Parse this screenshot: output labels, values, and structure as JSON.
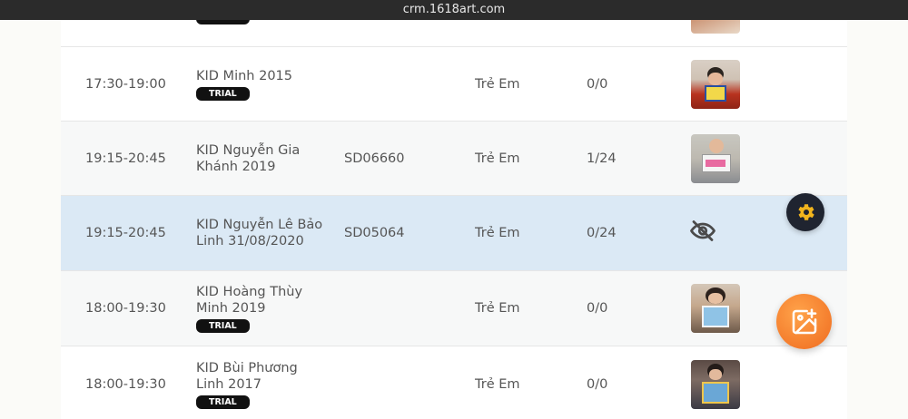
{
  "browser": {
    "url": "crm.1618art.com"
  },
  "rows": [
    {
      "time": "",
      "name": "",
      "badge": "TRIAL",
      "code": "",
      "type": "",
      "count": "",
      "thumb": "photo-thumbnail"
    },
    {
      "time": "17:30-19:00",
      "name": "KID Minh 2015",
      "badge": "TRIAL",
      "code": "",
      "type": "Trẻ Em",
      "count": "0/0",
      "thumb": "photo-thumbnail"
    },
    {
      "time": "19:15-20:45",
      "name": "KID Nguyễn Gia Khánh 2019",
      "badge": "",
      "code": "SD06660",
      "type": "Trẻ Em",
      "count": "1/24",
      "thumb": "photo-thumbnail"
    },
    {
      "time": "19:15-20:45",
      "name": "KID Nguyễn Lê Bảo Linh 31/08/2020",
      "badge": "",
      "code": "SD05064",
      "type": "Trẻ Em",
      "count": "0/24",
      "thumb": "eye-off-icon"
    },
    {
      "time": "18:00-19:30",
      "name": "KID Hoàng Thùy Minh 2019",
      "badge": "TRIAL",
      "code": "",
      "type": "Trẻ Em",
      "count": "0/0",
      "thumb": "photo-thumbnail"
    },
    {
      "time": "18:00-19:30",
      "name": "KID Bùi Phương Linh 2017",
      "badge": "TRIAL",
      "code": "",
      "type": "Trẻ Em",
      "count": "0/0",
      "thumb": "photo-thumbnail"
    }
  ],
  "fabs": {
    "settings": "gear-icon",
    "image_upload": "image-add-icon"
  },
  "colors": {
    "highlight_row": "#dbe9f5",
    "badge": "#111111",
    "fab_gear": "#1f2430",
    "gear": "#f2b51d",
    "fab_image": "#f07a26"
  }
}
